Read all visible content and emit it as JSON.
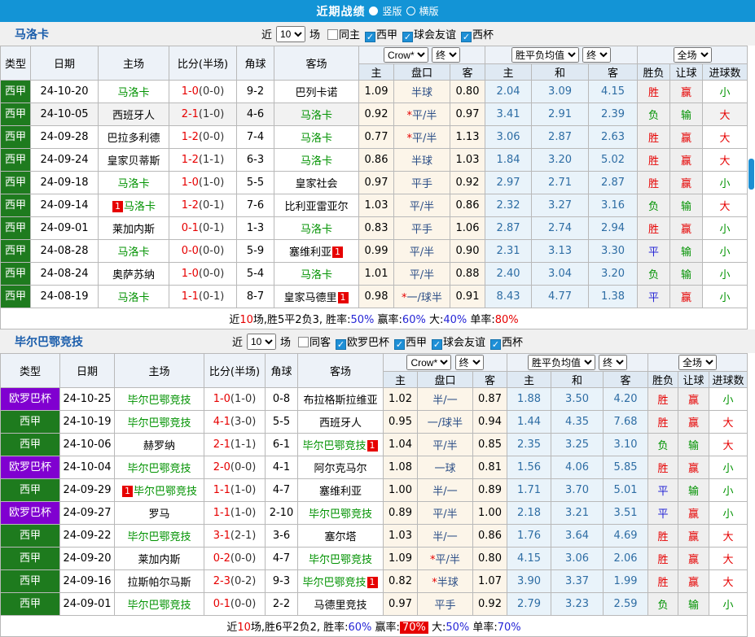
{
  "topbar": {
    "title": "近期战绩",
    "radio_vertical": "竖版",
    "radio_horizontal": "横版"
  },
  "filters": {
    "near": "近",
    "count": "10",
    "games": "场"
  },
  "selects": {
    "crow": "Crow*",
    "final": "终",
    "avg": "胜平负均值",
    "full": "全场"
  },
  "headers": {
    "type": "类型",
    "date": "日期",
    "home": "主场",
    "score": "比分(半场)",
    "corner": "角球",
    "away": "客场",
    "h": "主",
    "handicap": "盘口",
    "a": "客",
    "h2": "主",
    "draw": "和",
    "a2": "客",
    "wdl": "胜负",
    "let": "让球",
    "goals": "进球数"
  },
  "colors": {
    "accent_blue": "#1394d6",
    "league_green": "#1e7b1e",
    "league_purple": "#8000d0",
    "team_green": "#009200",
    "score_red": "#e60000",
    "handicap_navy": "#2d4f87",
    "avg_blue": "#2e6da4",
    "result_red": "#e60000",
    "result_green": "#009200",
    "result_blue": "#2525d6",
    "bg_cream": "#fcf5e9",
    "bg_azure": "#e9f3fa",
    "bg_gray": "#efefef"
  },
  "sections": [
    {
      "team": "马洛卡",
      "checkboxes": [
        {
          "label": "同主",
          "checked": false
        },
        {
          "label": "西甲",
          "checked": true
        },
        {
          "label": "球会友谊",
          "checked": true
        },
        {
          "label": "西杯",
          "checked": true
        }
      ],
      "rows": [
        {
          "league": "西甲",
          "lc": "g",
          "date": "24-10-20",
          "home": {
            "n": "马洛卡",
            "g": 1
          },
          "score": "1-0",
          "half": "(0-0)",
          "corner": "9-2",
          "away": {
            "n": "巴列卡诺",
            "g": 0
          },
          "o1": "1.09",
          "star": 0,
          "hc": "半球",
          "o2": "0.80",
          "m": [
            "2.04",
            "3.09",
            "4.15"
          ],
          "res": [
            [
              "胜",
              "r"
            ],
            [
              "赢",
              "r"
            ],
            [
              "小",
              "g"
            ]
          ],
          "hl": 0
        },
        {
          "league": "西甲",
          "lc": "g",
          "date": "24-10-05",
          "home": {
            "n": "西班牙人",
            "g": 0
          },
          "score": "2-1",
          "half": "(1-0)",
          "corner": "4-6",
          "away": {
            "n": "马洛卡",
            "g": 1
          },
          "o1": "0.92",
          "star": 1,
          "hc": "平/半",
          "o2": "0.97",
          "m": [
            "3.41",
            "2.91",
            "2.39"
          ],
          "res": [
            [
              "负",
              "g"
            ],
            [
              "输",
              "g"
            ],
            [
              "大",
              "r"
            ]
          ],
          "hl": 1
        },
        {
          "league": "西甲",
          "lc": "g",
          "date": "24-09-28",
          "home": {
            "n": "巴拉多利德",
            "g": 0
          },
          "score": "1-2",
          "half": "(0-0)",
          "corner": "7-4",
          "away": {
            "n": "马洛卡",
            "g": 1
          },
          "o1": "0.77",
          "star": 1,
          "hc": "平/半",
          "o2": "1.13",
          "m": [
            "3.06",
            "2.87",
            "2.63"
          ],
          "res": [
            [
              "胜",
              "r"
            ],
            [
              "赢",
              "r"
            ],
            [
              "大",
              "r"
            ]
          ],
          "hl": 0
        },
        {
          "league": "西甲",
          "lc": "g",
          "date": "24-09-24",
          "home": {
            "n": "皇家贝蒂斯",
            "g": 0
          },
          "score": "1-2",
          "half": "(1-1)",
          "corner": "6-3",
          "away": {
            "n": "马洛卡",
            "g": 1
          },
          "o1": "0.86",
          "star": 0,
          "hc": "半球",
          "o2": "1.03",
          "m": [
            "1.84",
            "3.20",
            "5.02"
          ],
          "res": [
            [
              "胜",
              "r"
            ],
            [
              "赢",
              "r"
            ],
            [
              "大",
              "r"
            ]
          ],
          "hl": 0
        },
        {
          "league": "西甲",
          "lc": "g",
          "date": "24-09-18",
          "home": {
            "n": "马洛卡",
            "g": 1
          },
          "score": "1-0",
          "half": "(1-0)",
          "corner": "5-5",
          "away": {
            "n": "皇家社会",
            "g": 0
          },
          "o1": "0.97",
          "star": 0,
          "hc": "平手",
          "o2": "0.92",
          "m": [
            "2.97",
            "2.71",
            "2.87"
          ],
          "res": [
            [
              "胜",
              "r"
            ],
            [
              "赢",
              "r"
            ],
            [
              "小",
              "g"
            ]
          ],
          "hl": 0
        },
        {
          "league": "西甲",
          "lc": "g",
          "date": "24-09-14",
          "home": {
            "n": "马洛卡",
            "g": 1,
            "b": "before"
          },
          "score": "1-2",
          "half": "(0-1)",
          "corner": "7-6",
          "away": {
            "n": "比利亚雷亚尔",
            "g": 0
          },
          "o1": "1.03",
          "star": 0,
          "hc": "平/半",
          "o2": "0.86",
          "m": [
            "2.32",
            "3.27",
            "3.16"
          ],
          "res": [
            [
              "负",
              "g"
            ],
            [
              "输",
              "g"
            ],
            [
              "大",
              "r"
            ]
          ],
          "hl": 0
        },
        {
          "league": "西甲",
          "lc": "g",
          "date": "24-09-01",
          "home": {
            "n": "莱加内斯",
            "g": 0
          },
          "score": "0-1",
          "half": "(0-1)",
          "corner": "1-3",
          "away": {
            "n": "马洛卡",
            "g": 1
          },
          "o1": "0.83",
          "star": 0,
          "hc": "平手",
          "o2": "1.06",
          "m": [
            "2.87",
            "2.74",
            "2.94"
          ],
          "res": [
            [
              "胜",
              "r"
            ],
            [
              "赢",
              "r"
            ],
            [
              "小",
              "g"
            ]
          ],
          "hl": 0
        },
        {
          "league": "西甲",
          "lc": "g",
          "date": "24-08-28",
          "home": {
            "n": "马洛卡",
            "g": 1
          },
          "score": "0-0",
          "half": "(0-0)",
          "corner": "5-9",
          "away": {
            "n": "塞维利亚",
            "g": 0,
            "b": "after"
          },
          "o1": "0.99",
          "star": 0,
          "hc": "平/半",
          "o2": "0.90",
          "m": [
            "2.31",
            "3.13",
            "3.30"
          ],
          "res": [
            [
              "平",
              "b"
            ],
            [
              "输",
              "g"
            ],
            [
              "小",
              "g"
            ]
          ],
          "hl": 0
        },
        {
          "league": "西甲",
          "lc": "g",
          "date": "24-08-24",
          "home": {
            "n": "奥萨苏纳",
            "g": 0
          },
          "score": "1-0",
          "half": "(0-0)",
          "corner": "5-4",
          "away": {
            "n": "马洛卡",
            "g": 1
          },
          "o1": "1.01",
          "star": 0,
          "hc": "平/半",
          "o2": "0.88",
          "m": [
            "2.40",
            "3.04",
            "3.20"
          ],
          "res": [
            [
              "负",
              "g"
            ],
            [
              "输",
              "g"
            ],
            [
              "小",
              "g"
            ]
          ],
          "hl": 0
        },
        {
          "league": "西甲",
          "lc": "g",
          "date": "24-08-19",
          "home": {
            "n": "马洛卡",
            "g": 1
          },
          "score": "1-1",
          "half": "(0-1)",
          "corner": "8-7",
          "away": {
            "n": "皇家马德里",
            "g": 0,
            "b": "after"
          },
          "o1": "0.98",
          "star": 1,
          "hc": "一/球半",
          "o2": "0.91",
          "m": [
            "8.43",
            "4.77",
            "1.38"
          ],
          "res": [
            [
              "平",
              "b"
            ],
            [
              "赢",
              "r"
            ],
            [
              "小",
              "g"
            ]
          ],
          "hl": 0
        }
      ],
      "summary": [
        [
          "近",
          "ck"
        ],
        [
          "10",
          "cr"
        ],
        [
          "场,胜5平2负3, 胜率:",
          "ck"
        ],
        [
          "50%",
          "cbl"
        ],
        [
          " 赢率:",
          "ck"
        ],
        [
          "60%",
          "cbl"
        ],
        [
          " 大:",
          "ck"
        ],
        [
          "40%",
          "cbl"
        ],
        [
          " 单率:",
          "ck"
        ],
        [
          "80%",
          "cr"
        ]
      ]
    },
    {
      "team": "毕尔巴鄂竞技",
      "checkboxes": [
        {
          "label": "同客",
          "checked": false
        },
        {
          "label": "欧罗巴杯",
          "checked": true
        },
        {
          "label": "西甲",
          "checked": true
        },
        {
          "label": "球会友谊",
          "checked": true
        },
        {
          "label": "西杯",
          "checked": true
        }
      ],
      "rows": [
        {
          "league": "欧罗巴杯",
          "lc": "p",
          "date": "24-10-25",
          "home": {
            "n": "毕尔巴鄂竞技",
            "g": 1
          },
          "score": "1-0",
          "half": "(1-0)",
          "corner": "0-8",
          "away": {
            "n": "布拉格斯拉维亚",
            "g": 0
          },
          "o1": "1.02",
          "star": 0,
          "hc": "半/一",
          "o2": "0.87",
          "m": [
            "1.88",
            "3.50",
            "4.20"
          ],
          "res": [
            [
              "胜",
              "r"
            ],
            [
              "赢",
              "r"
            ],
            [
              "小",
              "g"
            ]
          ],
          "hl": 0
        },
        {
          "league": "西甲",
          "lc": "g",
          "date": "24-10-19",
          "home": {
            "n": "毕尔巴鄂竞技",
            "g": 1
          },
          "score": "4-1",
          "half": "(3-0)",
          "corner": "5-5",
          "away": {
            "n": "西班牙人",
            "g": 0
          },
          "o1": "0.95",
          "star": 0,
          "hc": "一/球半",
          "o2": "0.94",
          "m": [
            "1.44",
            "4.35",
            "7.68"
          ],
          "res": [
            [
              "胜",
              "r"
            ],
            [
              "赢",
              "r"
            ],
            [
              "大",
              "r"
            ]
          ],
          "hl": 0
        },
        {
          "league": "西甲",
          "lc": "g",
          "date": "24-10-06",
          "home": {
            "n": "赫罗纳",
            "g": 0
          },
          "score": "2-1",
          "half": "(1-1)",
          "corner": "6-1",
          "away": {
            "n": "毕尔巴鄂竞技",
            "g": 1,
            "b": "after"
          },
          "o1": "1.04",
          "star": 0,
          "hc": "平/半",
          "o2": "0.85",
          "m": [
            "2.35",
            "3.25",
            "3.10"
          ],
          "res": [
            [
              "负",
              "g"
            ],
            [
              "输",
              "g"
            ],
            [
              "大",
              "r"
            ]
          ],
          "hl": 0
        },
        {
          "league": "欧罗巴杯",
          "lc": "p",
          "date": "24-10-04",
          "home": {
            "n": "毕尔巴鄂竞技",
            "g": 1
          },
          "score": "2-0",
          "half": "(0-0)",
          "corner": "4-1",
          "away": {
            "n": "阿尔克马尔",
            "g": 0
          },
          "o1": "1.08",
          "star": 0,
          "hc": "一球",
          "o2": "0.81",
          "m": [
            "1.56",
            "4.06",
            "5.85"
          ],
          "res": [
            [
              "胜",
              "r"
            ],
            [
              "赢",
              "r"
            ],
            [
              "小",
              "g"
            ]
          ],
          "hl": 0
        },
        {
          "league": "西甲",
          "lc": "g",
          "date": "24-09-29",
          "home": {
            "n": "毕尔巴鄂竞技",
            "g": 1,
            "b": "before"
          },
          "score": "1-1",
          "half": "(1-0)",
          "corner": "4-7",
          "away": {
            "n": "塞维利亚",
            "g": 0
          },
          "o1": "1.00",
          "star": 0,
          "hc": "半/一",
          "o2": "0.89",
          "m": [
            "1.71",
            "3.70",
            "5.01"
          ],
          "res": [
            [
              "平",
              "b"
            ],
            [
              "输",
              "g"
            ],
            [
              "小",
              "g"
            ]
          ],
          "hl": 0
        },
        {
          "league": "欧罗巴杯",
          "lc": "p",
          "date": "24-09-27",
          "home": {
            "n": "罗马",
            "g": 0
          },
          "score": "1-1",
          "half": "(1-0)",
          "corner": "2-10",
          "away": {
            "n": "毕尔巴鄂竞技",
            "g": 1
          },
          "o1": "0.89",
          "star": 0,
          "hc": "平/半",
          "o2": "1.00",
          "m": [
            "2.18",
            "3.21",
            "3.51"
          ],
          "res": [
            [
              "平",
              "b"
            ],
            [
              "赢",
              "r"
            ],
            [
              "小",
              "g"
            ]
          ],
          "hl": 0
        },
        {
          "league": "西甲",
          "lc": "g",
          "date": "24-09-22",
          "home": {
            "n": "毕尔巴鄂竞技",
            "g": 1
          },
          "score": "3-1",
          "half": "(2-1)",
          "corner": "3-6",
          "away": {
            "n": "塞尔塔",
            "g": 0
          },
          "o1": "1.03",
          "star": 0,
          "hc": "半/一",
          "o2": "0.86",
          "m": [
            "1.76",
            "3.64",
            "4.69"
          ],
          "res": [
            [
              "胜",
              "r"
            ],
            [
              "赢",
              "r"
            ],
            [
              "大",
              "r"
            ]
          ],
          "hl": 0
        },
        {
          "league": "西甲",
          "lc": "g",
          "date": "24-09-20",
          "home": {
            "n": "莱加内斯",
            "g": 0
          },
          "score": "0-2",
          "half": "(0-0)",
          "corner": "4-7",
          "away": {
            "n": "毕尔巴鄂竞技",
            "g": 1
          },
          "o1": "1.09",
          "star": 1,
          "hc": "平/半",
          "o2": "0.80",
          "m": [
            "4.15",
            "3.06",
            "2.06"
          ],
          "res": [
            [
              "胜",
              "r"
            ],
            [
              "赢",
              "r"
            ],
            [
              "大",
              "r"
            ]
          ],
          "hl": 0
        },
        {
          "league": "西甲",
          "lc": "g",
          "date": "24-09-16",
          "home": {
            "n": "拉斯帕尔马斯",
            "g": 0
          },
          "score": "2-3",
          "half": "(0-2)",
          "corner": "9-3",
          "away": {
            "n": "毕尔巴鄂竞技",
            "g": 1,
            "b": "after"
          },
          "o1": "0.82",
          "star": 1,
          "hc": "半球",
          "o2": "1.07",
          "m": [
            "3.90",
            "3.37",
            "1.99"
          ],
          "res": [
            [
              "胜",
              "r"
            ],
            [
              "赢",
              "r"
            ],
            [
              "大",
              "r"
            ]
          ],
          "hl": 0
        },
        {
          "league": "西甲",
          "lc": "g",
          "date": "24-09-01",
          "home": {
            "n": "毕尔巴鄂竞技",
            "g": 1
          },
          "score": "0-1",
          "half": "(0-0)",
          "corner": "2-2",
          "away": {
            "n": "马德里竞技",
            "g": 0
          },
          "o1": "0.97",
          "star": 0,
          "hc": "平手",
          "o2": "0.92",
          "m": [
            "2.79",
            "3.23",
            "2.59"
          ],
          "res": [
            [
              "负",
              "g"
            ],
            [
              "输",
              "g"
            ],
            [
              "小",
              "g"
            ]
          ],
          "hl": 0
        }
      ],
      "summary": [
        [
          "近",
          "ck"
        ],
        [
          "10",
          "cr"
        ],
        [
          "场,胜6平2负2, 胜率:",
          "ck"
        ],
        [
          "60%",
          "cbl"
        ],
        [
          " 赢率:",
          "ck"
        ],
        [
          "70%",
          "crbg"
        ],
        [
          " 大:",
          "ck"
        ],
        [
          "50%",
          "cbl"
        ],
        [
          " 单率:",
          "ck"
        ],
        [
          "70%",
          "cbl"
        ]
      ]
    }
  ]
}
